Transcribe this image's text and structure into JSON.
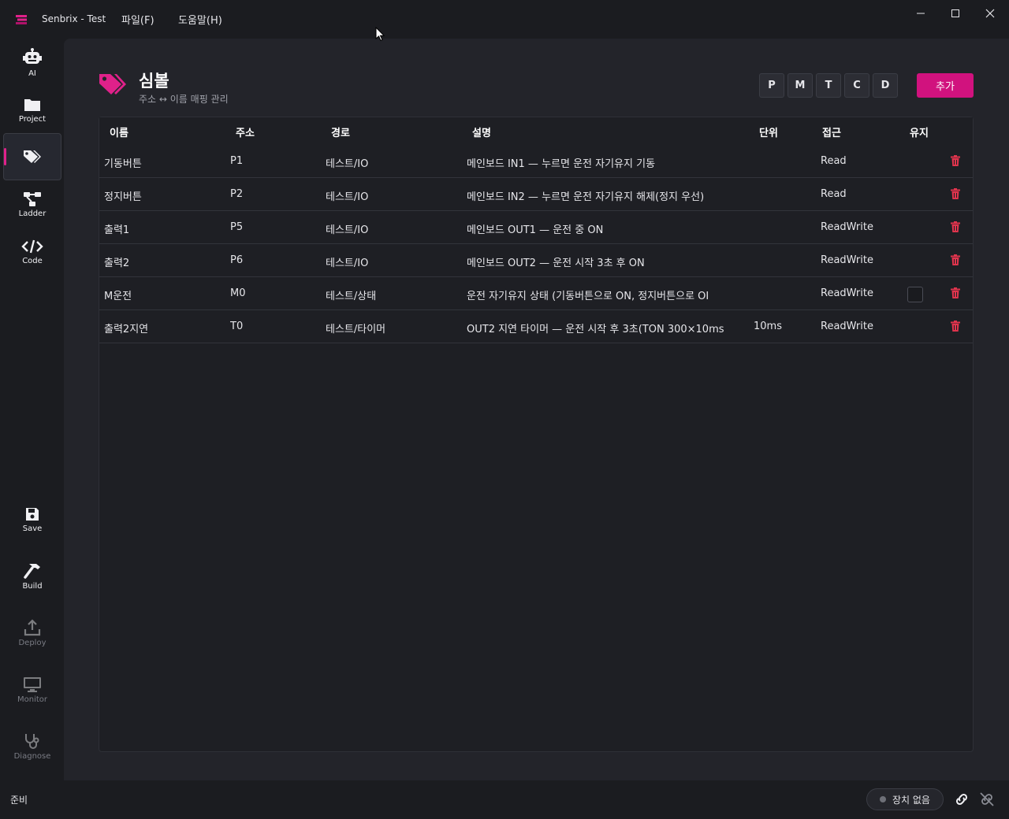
{
  "app": {
    "title": "Senbrix - Test",
    "menus": [
      "파일(F)",
      "도움말(H)"
    ]
  },
  "sidebar": {
    "items": [
      {
        "label": "AI",
        "icon": "robot-icon"
      },
      {
        "label": "Project",
        "icon": "folder-icon"
      },
      {
        "label": "",
        "icon": "tags-icon",
        "active": true
      },
      {
        "label": "Ladder",
        "icon": "ladder-diagram-icon"
      },
      {
        "label": "Code",
        "icon": "code-icon"
      },
      {
        "label": "Save",
        "icon": "save-icon"
      },
      {
        "label": "Build",
        "icon": "hammer-icon"
      },
      {
        "label": "Deploy",
        "icon": "upload-icon",
        "disabled": true
      },
      {
        "label": "Monitor",
        "icon": "monitor-icon",
        "disabled": true
      },
      {
        "label": "Diagnose",
        "icon": "stethoscope-icon",
        "disabled": true
      }
    ]
  },
  "page": {
    "title": "심볼",
    "subtitle": "주소 ↔ 이름 매핑 관리",
    "filters": [
      "P",
      "M",
      "T",
      "C",
      "D"
    ],
    "add_label": "추가"
  },
  "table": {
    "columns": [
      "이름",
      "주소",
      "경로",
      "설명",
      "단위",
      "접근",
      "유지"
    ],
    "rows": [
      {
        "name": "기동버튼",
        "addr": "P1",
        "path": "테스트/IO",
        "desc": "메인보드 IN1 — 누르면 운전 자기유지 기동",
        "unit": "",
        "access": "Read",
        "keep": false,
        "keep_visible": false
      },
      {
        "name": "정지버튼",
        "addr": "P2",
        "path": "테스트/IO",
        "desc": "메인보드 IN2 — 누르면 운전 자기유지 해제(정지 우선)",
        "unit": "",
        "access": "Read",
        "keep": false,
        "keep_visible": false
      },
      {
        "name": "출력1",
        "addr": "P5",
        "path": "테스트/IO",
        "desc": "메인보드 OUT1 — 운전 중 ON",
        "unit": "",
        "access": "ReadWrite",
        "keep": false,
        "keep_visible": false
      },
      {
        "name": "출력2",
        "addr": "P6",
        "path": "테스트/IO",
        "desc": "메인보드 OUT2 — 운전 시작 3초 후 ON",
        "unit": "",
        "access": "ReadWrite",
        "keep": false,
        "keep_visible": false
      },
      {
        "name": "M운전",
        "addr": "M0",
        "path": "테스트/상태",
        "desc": "운전 자기유지 상태 (기동버튼으로 ON, 정지버튼으로 OI",
        "unit": "",
        "access": "ReadWrite",
        "keep": false,
        "keep_visible": true
      },
      {
        "name": "출력2지연",
        "addr": "T0",
        "path": "테스트/타이머",
        "desc": "OUT2 지연 타이머 — 운전 시작 후 3초(TON 300×10ms",
        "unit": "10ms",
        "access": "ReadWrite",
        "keep": false,
        "keep_visible": false
      }
    ]
  },
  "status": {
    "text": "준비",
    "device": "장치 없음"
  },
  "colors": {
    "accent": "#d1127e",
    "delete": "#e0344d"
  }
}
